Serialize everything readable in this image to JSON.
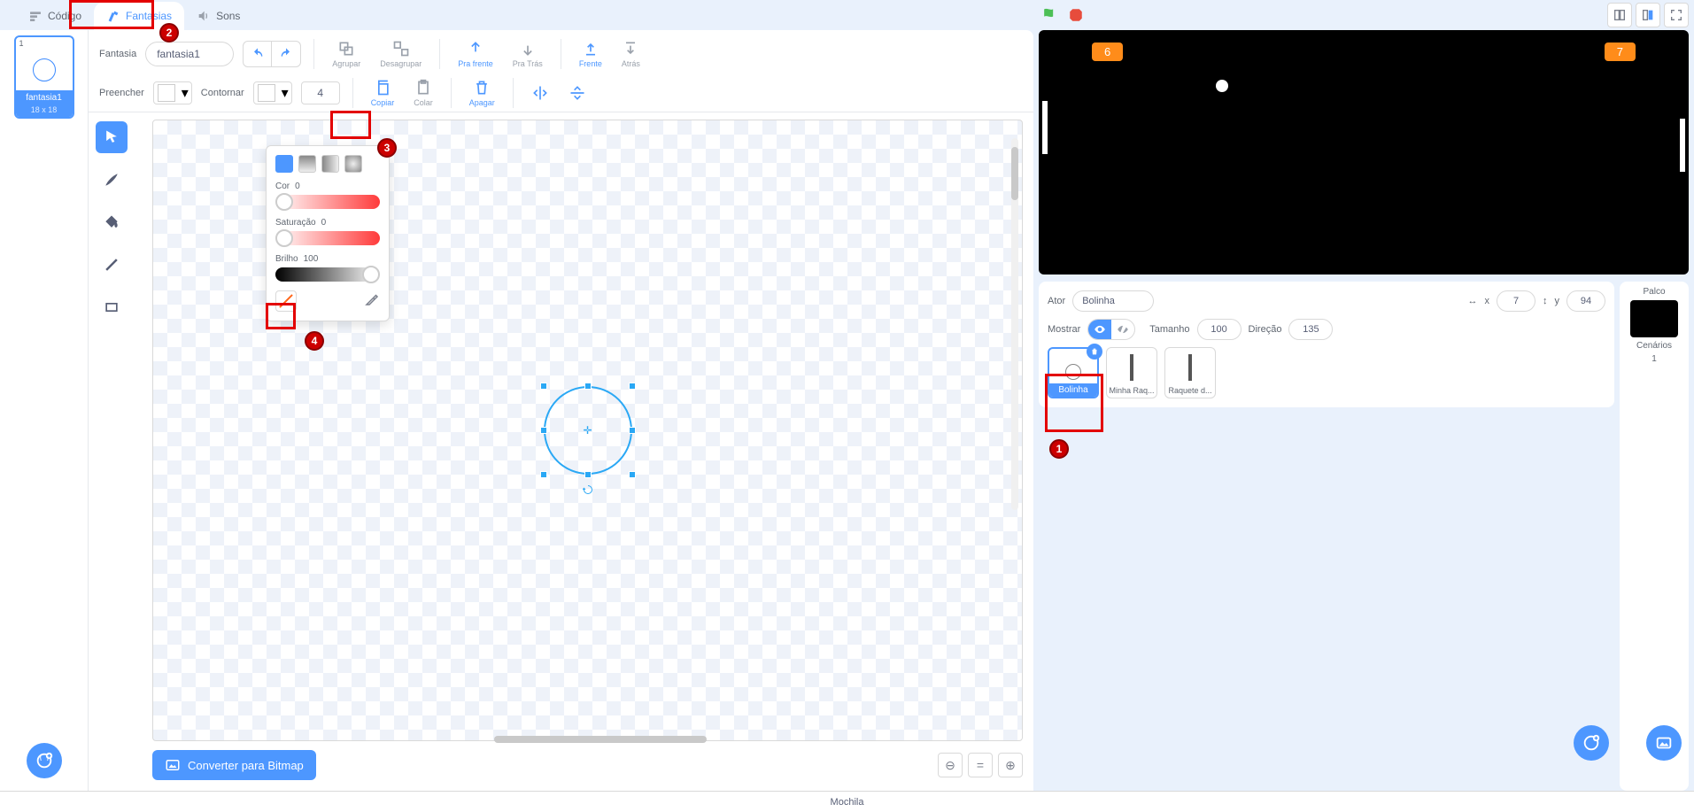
{
  "tabs": {
    "code": "Código",
    "costumes": "Fantasias",
    "sounds": "Sons"
  },
  "costume_list": {
    "index": "1",
    "name": "fantasia1",
    "size": "18 x 18"
  },
  "header": {
    "costume_label": "Fantasia",
    "costume_name": "fantasia1",
    "group": "Agrupar",
    "ungroup": "Desagrupar",
    "front": "Pra frente",
    "back": "Pra Trás",
    "forward": "Frente",
    "backward": "Atrás",
    "fill_label": "Preencher",
    "outline_label": "Contornar",
    "stroke_width": "4",
    "copy": "Copiar",
    "paste": "Colar",
    "delete": "Apagar"
  },
  "color_picker": {
    "hue_label": "Cor",
    "hue_val": "0",
    "sat_label": "Saturação",
    "sat_val": "0",
    "bri_label": "Brilho",
    "bri_val": "100"
  },
  "bitmap_btn": "Converter para Bitmap",
  "stage_scores": {
    "left": "6",
    "right": "7"
  },
  "sprite_info": {
    "actor_label": "Ator",
    "actor_name": "Bolinha",
    "x_label": "x",
    "x_val": "7",
    "y_label": "y",
    "y_val": "94",
    "show_label": "Mostrar",
    "size_label": "Tamanho",
    "size_val": "100",
    "dir_label": "Direção",
    "dir_val": "135"
  },
  "sprites": {
    "s1": "Bolinha",
    "s2": "Minha Raq...",
    "s3": "Raquete d..."
  },
  "stage_panel": {
    "title": "Palco",
    "backdrops_label": "Cenários",
    "backdrops_count": "1"
  },
  "backpack": "Mochila"
}
